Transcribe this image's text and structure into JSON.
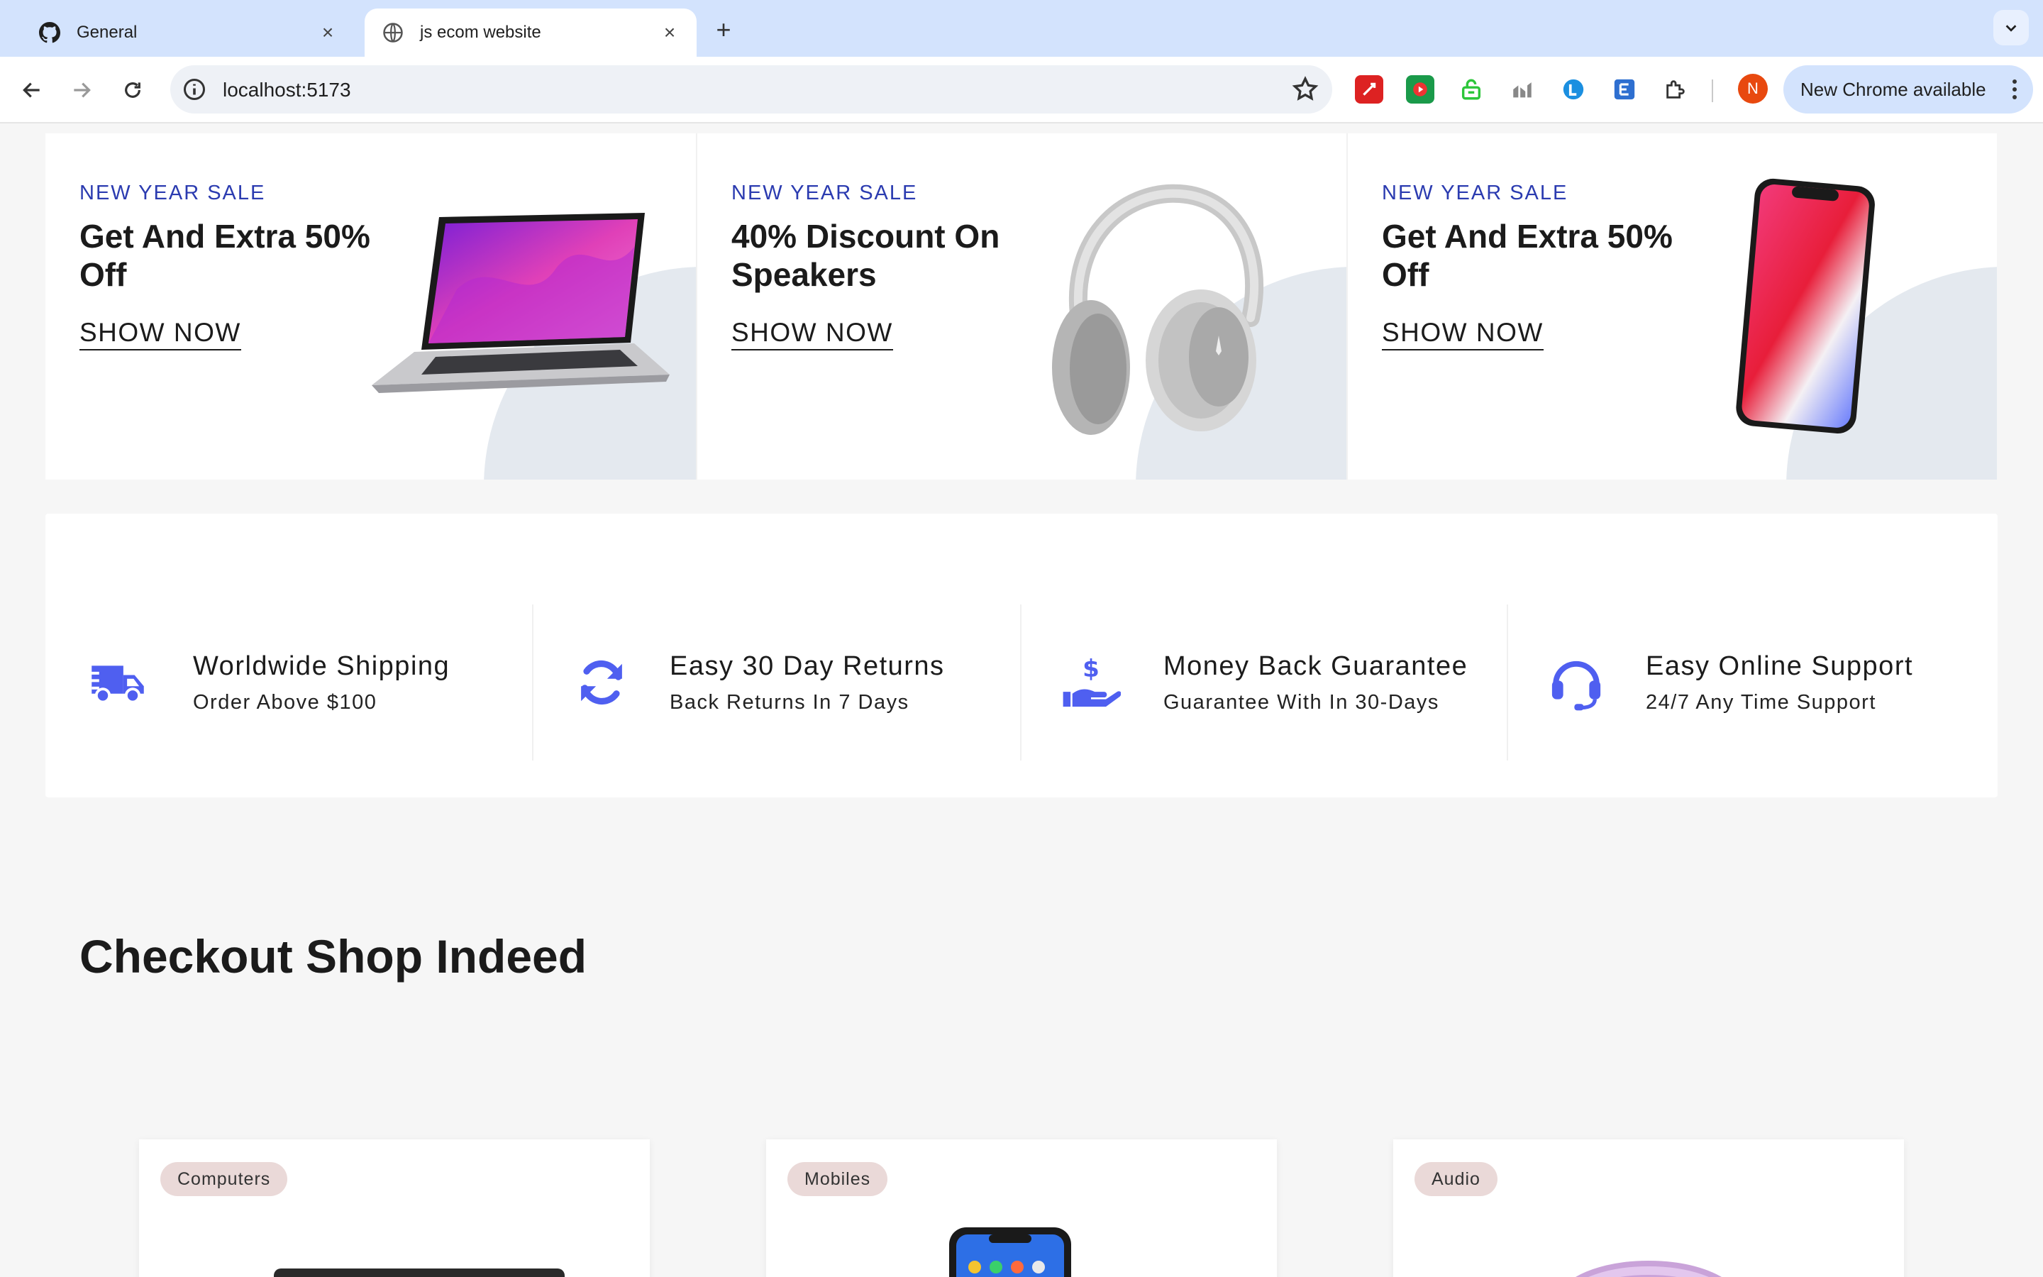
{
  "browser": {
    "tabs": [
      {
        "title": "General",
        "icon": "github-icon",
        "active": false
      },
      {
        "title": "js ecom website",
        "icon": "globe-icon",
        "active": true
      }
    ],
    "address": "localhost:5173",
    "update_label": "New Chrome available",
    "profile_initial": "N"
  },
  "banners": [
    {
      "eyebrow": "NEW YEAR SALE",
      "heading": "Get And Extra 50% Off",
      "cta": "SHOW NOW",
      "image": "laptop"
    },
    {
      "eyebrow": "NEW YEAR SALE",
      "heading": "40% Discount On Speakers",
      "cta": "SHOW NOW",
      "image": "headphones"
    },
    {
      "eyebrow": "NEW YEAR SALE",
      "heading": "Get And Extra 50% Off",
      "cta": "SHOW NOW",
      "image": "smartphone"
    }
  ],
  "features": [
    {
      "title": "Worldwide Shipping",
      "subtitle": "Order Above $100",
      "icon": "truck-icon"
    },
    {
      "title": "Easy 30 Day Returns",
      "subtitle": "Back Returns In 7 Days",
      "icon": "refresh-icon"
    },
    {
      "title": "Money Back Guarantee",
      "subtitle": "Guarantee With In 30-Days",
      "icon": "money-hand-icon"
    },
    {
      "title": "Easy Online Support",
      "subtitle": "24/7 Any Time Support",
      "icon": "headset-icon"
    }
  ],
  "section": {
    "title": "Checkout Shop Indeed"
  },
  "categories": [
    {
      "label": "Computers"
    },
    {
      "label": "Mobiles"
    },
    {
      "label": "Audio"
    }
  ],
  "colors": {
    "accent": "#2b3bb0",
    "icon_blue": "#4f5ff0",
    "badge": "#ead9d8"
  }
}
